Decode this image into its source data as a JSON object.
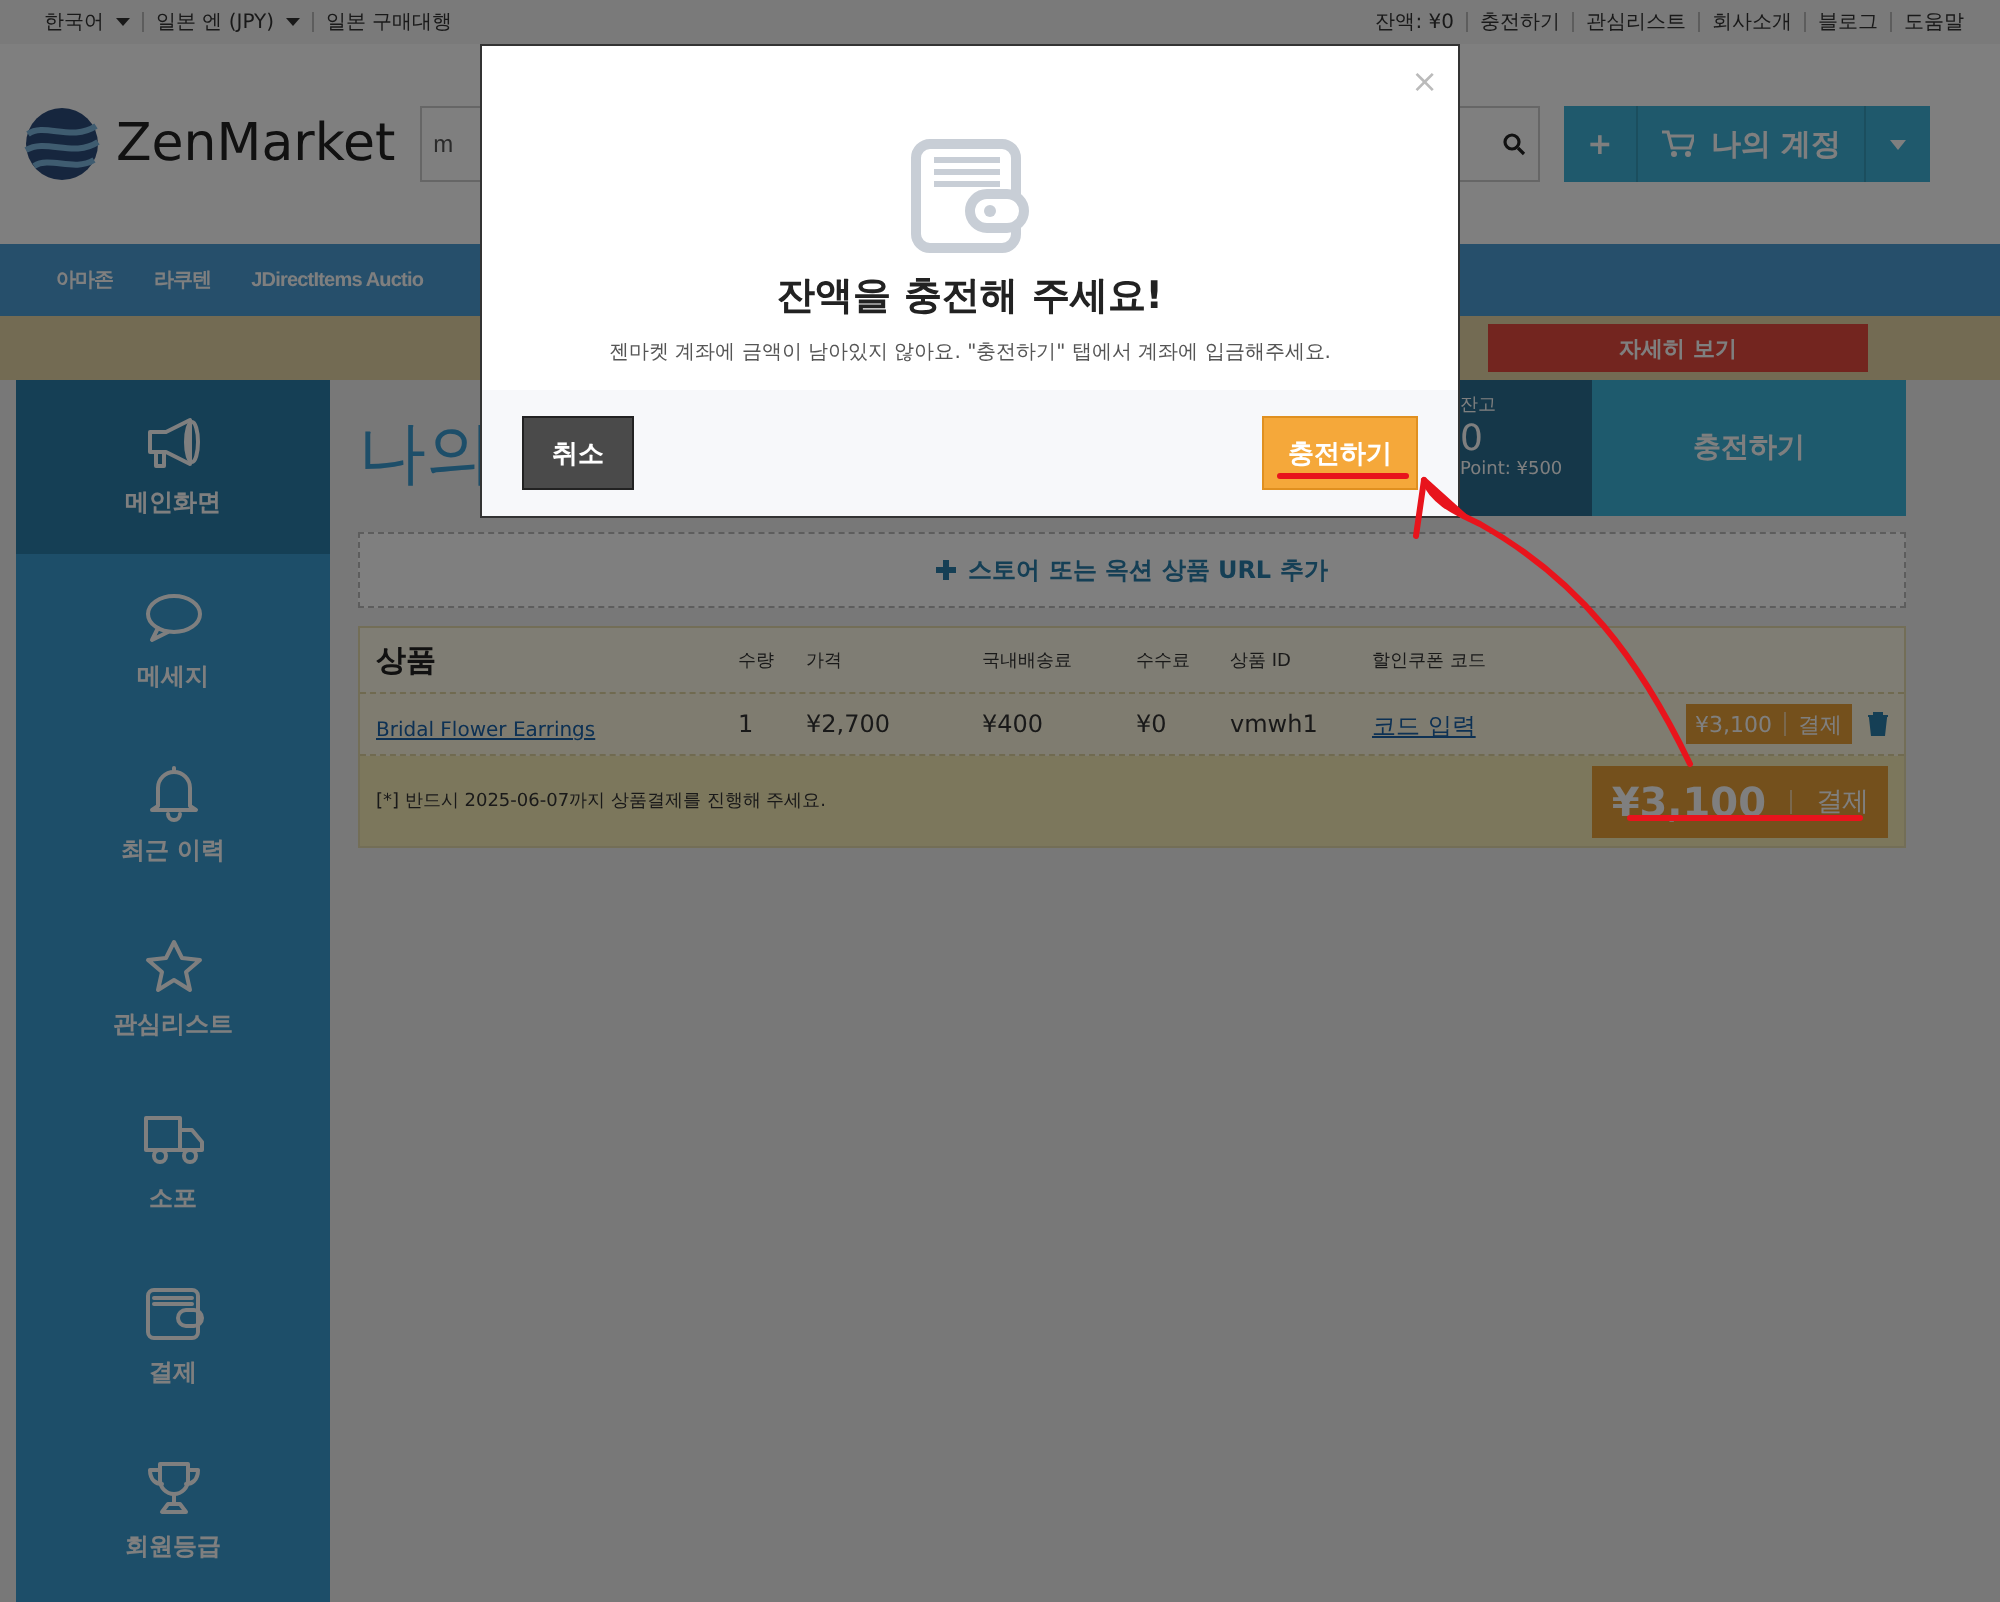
{
  "top_bar": {
    "left": [
      {
        "label": "한국어",
        "dropdown": true
      },
      {
        "label": "일본 엔 (JPY)",
        "dropdown": true
      },
      {
        "label": "일본 구매대행",
        "dropdown": false
      }
    ],
    "right": [
      "잔액: ¥0",
      "충전하기",
      "관심리스트",
      "회사소개",
      "블로그",
      "도움말"
    ]
  },
  "header": {
    "logo": "ZenMarket",
    "search": {
      "value": "m"
    },
    "plus": "+",
    "account": "나의 계정"
  },
  "nav": [
    "아마존",
    "라쿠텐",
    "JDirectItems Auctio"
  ],
  "banner": {
    "button": "자세히 보기"
  },
  "sidebar": [
    {
      "label": "메인화면",
      "selected": true
    },
    {
      "label": "메세지",
      "selected": false
    },
    {
      "label": "최근 이력",
      "selected": false
    },
    {
      "label": "관심리스트",
      "selected": false
    },
    {
      "label": "소포",
      "selected": false
    },
    {
      "label": "결제",
      "selected": false
    },
    {
      "label": "회원등급",
      "selected": false
    }
  ],
  "main": {
    "title": "나의",
    "balance": {
      "label": "잔고",
      "amount": "0",
      "points": "Point: ¥500"
    },
    "charge": "충전하기",
    "add_url": "스토어 또는 옥션 상품 URL 추가"
  },
  "cart": {
    "heading": "상품",
    "columns": [
      "수량",
      "가격",
      "국내배송료",
      "수수료",
      "상품 ID",
      "할인쿠폰 코드"
    ],
    "rows": [
      {
        "product": "Bridal Flower Earrings",
        "qty": "1",
        "price": "¥2,700",
        "shipping": "¥400",
        "fee": "¥0",
        "id": "vmwh1",
        "coupon": "코드 입력",
        "total": "¥3,100",
        "pay": "결제"
      }
    ],
    "note": "[*] 반드시 2025-06-07까지 상품결제를 진행해 주세요.",
    "total": "¥3,100",
    "pay": "결제"
  },
  "modal": {
    "close": "×",
    "title": "잔액을 충전해 주세요!",
    "message": "젠마켓 계좌에 금액이 남아있지 않아요. \"충전하기\" 탭에서 계좌에 입금해주세요.",
    "cancel": "취소",
    "confirm": "충전하기"
  }
}
